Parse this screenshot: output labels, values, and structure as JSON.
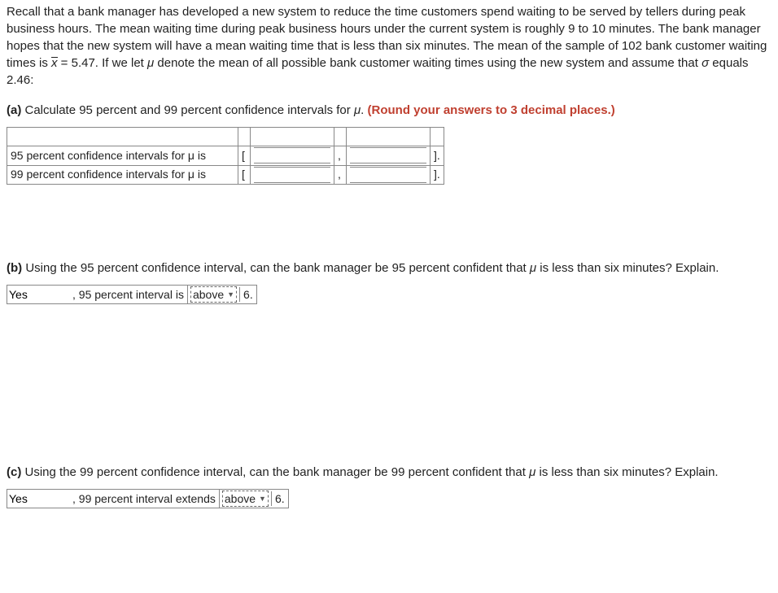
{
  "intro": "Recall that a bank manager has developed a new system to reduce the time customers spend waiting to be served by tellers during peak business hours. The mean waiting time during peak business hours under the current system is roughly 9 to 10 minutes. The bank manager hopes that the new system will have a mean waiting time that is less than six minutes. The mean of the sample of 102 bank customer waiting times is ",
  "intro2": " = 5.47. If we let ",
  "intro3": " denote the mean of all possible bank customer waiting times using the new system and assume that ",
  "intro4": " equals 2.46:",
  "xbar": "x",
  "mu": "μ",
  "sigma": "σ",
  "a": {
    "label": "(a)",
    "text": " Calculate 95 percent and 99 percent confidence intervals for ",
    "text2": ". ",
    "round": "(Round your answers to 3 decimal places.)",
    "row95": "95 percent confidence intervals for μ is",
    "row99": "99 percent confidence intervals for μ is",
    "openb": "[",
    "comma": ",",
    "closeb": "]."
  },
  "b": {
    "label": "(b)",
    "text": " Using the 95 percent confidence interval, can the bank manager be 95 percent confident that ",
    "text2": " is less than six minutes? Explain.",
    "yes": "Yes",
    "mid": ", 95 percent interval is",
    "drop": "above",
    "six": "6."
  },
  "c": {
    "label": "(c)",
    "text": " Using the 99 percent confidence interval, can the bank manager be 99 percent confident that ",
    "text2": " is less than six minutes? Explain.",
    "yes": "Yes",
    "mid": ", 99 percent interval extends",
    "drop": "above",
    "six": "6."
  }
}
